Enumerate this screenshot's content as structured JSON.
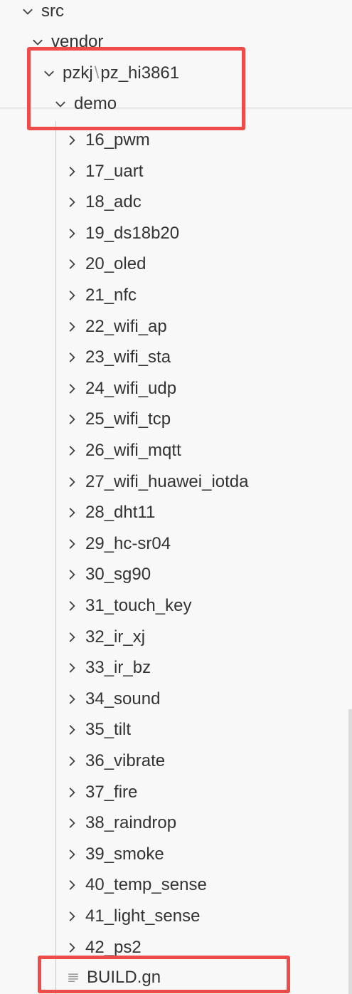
{
  "explorer": {
    "ancestors": [
      {
        "label": "src",
        "expanded": true
      },
      {
        "label": "vendor",
        "expanded": true
      }
    ],
    "compact_folder": {
      "part1": "pzkj",
      "separator": "\\",
      "part2": "pz_hi3861",
      "expanded": true
    },
    "demo_folder": {
      "label": "demo",
      "expanded": true
    },
    "items": [
      {
        "label": "16_pwm"
      },
      {
        "label": "17_uart"
      },
      {
        "label": "18_adc"
      },
      {
        "label": "19_ds18b20"
      },
      {
        "label": "20_oled"
      },
      {
        "label": "21_nfc"
      },
      {
        "label": "22_wifi_ap"
      },
      {
        "label": "23_wifi_sta"
      },
      {
        "label": "24_wifi_udp"
      },
      {
        "label": "25_wifi_tcp"
      },
      {
        "label": "26_wifi_mqtt"
      },
      {
        "label": "27_wifi_huawei_iotda"
      },
      {
        "label": "28_dht11"
      },
      {
        "label": "29_hc-sr04"
      },
      {
        "label": "30_sg90"
      },
      {
        "label": "31_touch_key"
      },
      {
        "label": "32_ir_xj"
      },
      {
        "label": "33_ir_bz"
      },
      {
        "label": "34_sound"
      },
      {
        "label": "35_tilt"
      },
      {
        "label": "36_vibrate"
      },
      {
        "label": "37_fire"
      },
      {
        "label": "38_raindrop"
      },
      {
        "label": "39_smoke"
      },
      {
        "label": "40_temp_sense"
      },
      {
        "label": "41_light_sense"
      },
      {
        "label": "42_ps2"
      }
    ],
    "file": {
      "label": "BUILD.gn",
      "icon": "lines-file-icon"
    }
  },
  "colors": {
    "background": "#f8f8f8",
    "text": "#333333",
    "highlight": "#ef4b4b",
    "indent_guide": "#c8c8c8"
  }
}
